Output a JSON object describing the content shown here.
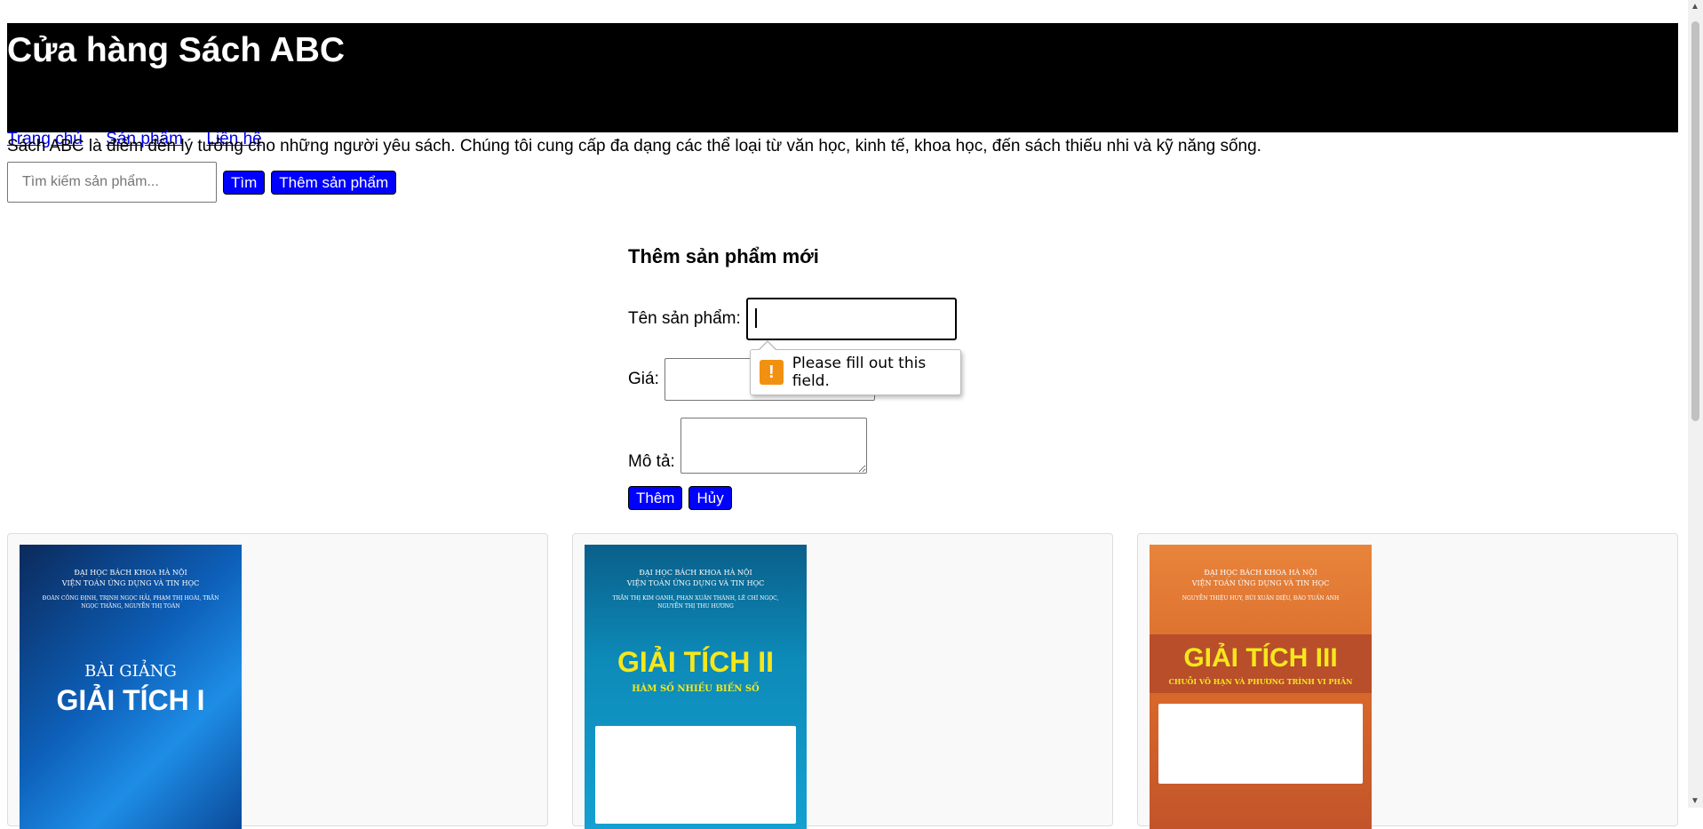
{
  "header": {
    "title": "Cửa hàng Sách ABC",
    "nav": [
      "Trang chủ",
      "Sản phẩm",
      "Liên hệ"
    ]
  },
  "intro": "Sách ABC là điểm đến lý tưởng cho những người yêu sách. Chúng tôi cung cấp đa dạng các thể loại từ văn học, kinh tế, khoa học, đến sách thiếu nhi và kỹ năng sống.",
  "search": {
    "placeholder": "Tìm kiếm sản phẩm...",
    "search_button": "Tìm",
    "add_button": "Thêm sản phẩm"
  },
  "form": {
    "title": "Thêm sản phẩm mới",
    "name_label": "Tên sản phẩm:",
    "price_label": "Giá:",
    "desc_label": "Mô tả:",
    "submit_label": "Thêm",
    "cancel_label": "Hủy",
    "validation_message": "Please fill out this field."
  },
  "products": [
    {
      "cover_institution": "ĐẠI HỌC BÁCH KHOA HÀ NỘI\nVIỆN TOÁN ỨNG DỤNG VÀ TIN HỌC",
      "cover_authors": "ĐOÀN CÔNG ĐỊNH, TRỊNH NGỌC HẢI, PHẠM THỊ HOÀI, TRẦN NGỌC THĂNG, NGUYỄN THỊ TOÀN",
      "cover_subtitle": "BÀI GIẢNG",
      "cover_title": "GIẢI TÍCH I"
    },
    {
      "cover_institution": "ĐẠI HỌC BÁCH KHOA HÀ NỘI\nVIỆN TOÁN ỨNG DỤNG VÀ TIN HỌC",
      "cover_authors": "TRẦN THỊ KIM OANH, PHAN XUÂN THÀNH, LÊ CHÍ NGỌC, NGUYỄN THỊ THU HƯƠNG",
      "cover_title": "GIẢI TÍCH II",
      "cover_subtitle": "HÀM SỐ NHIỀU BIẾN SỐ"
    },
    {
      "cover_institution": "ĐẠI HỌC BÁCH KHOA HÀ NỘI\nVIỆN TOÁN ỨNG DỤNG VÀ TIN HỌC",
      "cover_authors": "NGUYỄN THIỆU HUY, BÙI XUÂN DIỆU, ĐÀO TUẤN ANH",
      "cover_title": "GIẢI TÍCH III",
      "cover_subtitle": "CHUỖI VÔ HẠN VÀ PHƯƠNG TRÌNH VI PHÂN"
    }
  ],
  "colors": {
    "header_bg": "#000000",
    "button_bg": "#0000ff",
    "link": "#0000ee",
    "warning": "#f29111"
  }
}
